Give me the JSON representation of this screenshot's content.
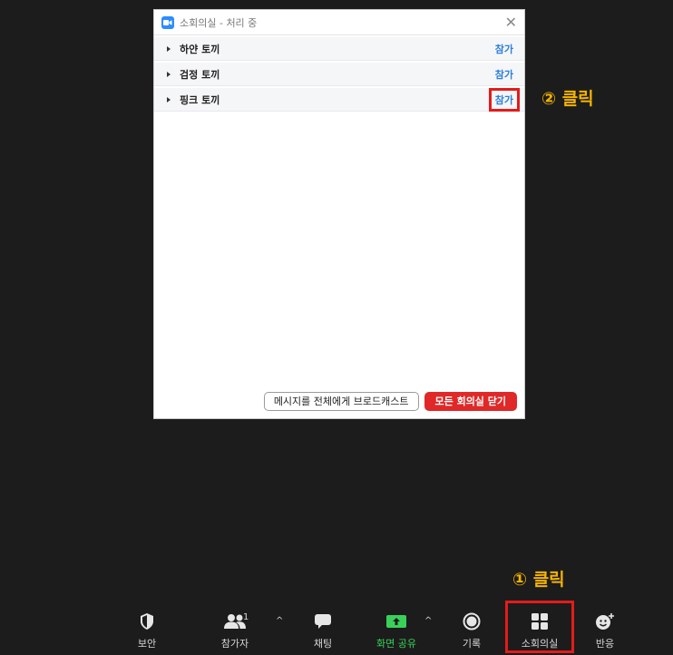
{
  "dialog": {
    "title": "소회의실 - 처리 중",
    "rooms": [
      {
        "name": "하얀 토끼",
        "action": "참가"
      },
      {
        "name": "검정 토끼",
        "action": "참가"
      },
      {
        "name": "핑크 토끼",
        "action": "참가"
      }
    ],
    "broadcast_label": "메시지를 전체에게 브로드캐스트",
    "close_all_label": "모든 회의실 닫기"
  },
  "annotations": {
    "step1": "① 클릭",
    "step2": "② 클릭"
  },
  "toolbar": {
    "security": "보안",
    "participants": "참가자",
    "participants_count": "1",
    "chat": "채팅",
    "share_screen": "화면 공유",
    "record": "기록",
    "breakout_rooms": "소회의실",
    "reactions": "반응"
  },
  "colors": {
    "background": "#1c1c1c",
    "join_link": "#2d7fd8",
    "highlight": "#e41b1b",
    "annotation": "#f4b400",
    "share_green": "#3ad15a",
    "close_all": "#e02828"
  }
}
